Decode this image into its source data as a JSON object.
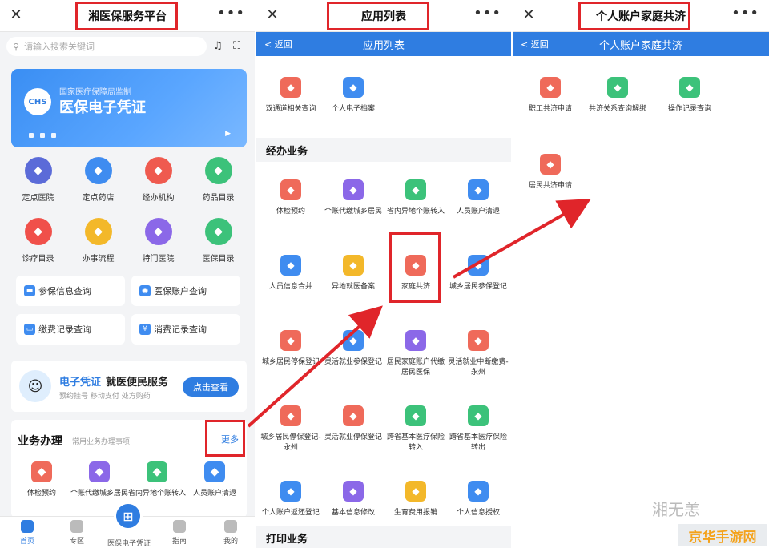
{
  "colors": {
    "accent": "#2f7de1",
    "highlight": "#e0252a"
  },
  "panel1": {
    "title": "湘医保服务平台",
    "close_icon": "close-icon",
    "more_icon": "more-icon",
    "search_placeholder": "请输入搜索关键词",
    "banner": {
      "sub": "国家医疗保障局监制",
      "title": "医保电子凭证",
      "logo": "CHS"
    },
    "grid": [
      {
        "label": "定点医院",
        "color": "#5b6bd8",
        "icon": "hospital-icon"
      },
      {
        "label": "定点药店",
        "color": "#3f8cf0",
        "icon": "pharmacy-icon"
      },
      {
        "label": "经办机构",
        "color": "#ef5a4f",
        "icon": "agency-icon"
      },
      {
        "label": "药品目录",
        "color": "#3cc27a",
        "icon": "medicine-icon"
      },
      {
        "label": "诊疗目录",
        "color": "#f0504a",
        "icon": "treatment-icon"
      },
      {
        "label": "办事流程",
        "color": "#f3b82a",
        "icon": "process-icon"
      },
      {
        "label": "特门医院",
        "color": "#8b68e8",
        "icon": "special-hospital-icon"
      },
      {
        "label": "医保目录",
        "color": "#3cc27a",
        "icon": "catalog-icon"
      }
    ],
    "quick": [
      {
        "label": "参保信息查询",
        "color": "#3f8cf0"
      },
      {
        "label": "医保账户查询",
        "color": "#3f8cf0"
      },
      {
        "label": "缴费记录查询",
        "color": "#3f8cf0"
      },
      {
        "label": "消费记录查询",
        "color": "#3f8cf0"
      }
    ],
    "evc": {
      "title": "电子凭证",
      "title2": "就医便民服务",
      "desc": "预约挂号   移动支付   处方购药",
      "button": "点击查看"
    },
    "biz": {
      "title": "业务办理",
      "sub": "常用业务办理事项",
      "more": "更多",
      "items": [
        {
          "label": "体检预约",
          "color": "#ef6a5a"
        },
        {
          "label": "个账代缴城乡居民",
          "color": "#8b68e8"
        },
        {
          "label": "省内异地个账转入",
          "color": "#3cc27a"
        },
        {
          "label": "人员账户清退",
          "color": "#3f8cf0"
        }
      ]
    },
    "nav": [
      {
        "label": "首页"
      },
      {
        "label": "专区"
      },
      {
        "label": "医保电子凭证"
      },
      {
        "label": "指南"
      },
      {
        "label": "我的"
      }
    ]
  },
  "panel2": {
    "title": "应用列表",
    "back": "< 返回",
    "subtitle": "应用列表",
    "top_items": [
      {
        "label": "双通道相关查询",
        "color": "#ef6a5a"
      },
      {
        "label": "个人电子档案",
        "color": "#3f8cf0"
      }
    ],
    "section1": "经办业务",
    "items": [
      {
        "label": "体检预约",
        "color": "#ef6a5a"
      },
      {
        "label": "个账代缴城乡居民",
        "color": "#8b68e8"
      },
      {
        "label": "省内异地个账转入",
        "color": "#3cc27a"
      },
      {
        "label": "人员账户清退",
        "color": "#3f8cf0"
      },
      {
        "label": "人员信息合并",
        "color": "#3f8cf0"
      },
      {
        "label": "异地就医备案",
        "color": "#f3b82a"
      },
      {
        "label": "家庭共济",
        "color": "#ef6a5a"
      },
      {
        "label": "城乡居民参保登记",
        "color": "#3f8cf0"
      },
      {
        "label": "城乡居民停保登记",
        "color": "#ef6a5a"
      },
      {
        "label": "灵活就业参保登记",
        "color": "#3f8cf0"
      },
      {
        "label": "居民家庭账户代缴居民医保",
        "color": "#8b68e8"
      },
      {
        "label": "灵活就业中断缴费-永州",
        "color": "#ef6a5a"
      },
      {
        "label": "城乡居民停保登记-永州",
        "color": "#ef6a5a"
      },
      {
        "label": "灵活就业停保登记",
        "color": "#ef6a5a"
      },
      {
        "label": "跨省基本医疗保险转入",
        "color": "#3cc27a"
      },
      {
        "label": "跨省基本医疗保险转出",
        "color": "#3cc27a"
      },
      {
        "label": "个人账户返还登记",
        "color": "#3f8cf0"
      },
      {
        "label": "基本信息修改",
        "color": "#8b68e8"
      },
      {
        "label": "生育费用报销",
        "color": "#f3b82a"
      },
      {
        "label": "个人信息授权",
        "color": "#3f8cf0"
      }
    ],
    "section2": "打印业务"
  },
  "panel3": {
    "title": "个人账户家庭共济",
    "back": "< 返回",
    "subtitle": "个人账户家庭共济",
    "items": [
      {
        "label": "职工共济申请",
        "color": "#ef6a5a"
      },
      {
        "label": "共济关系查询解绑",
        "color": "#3cc27a"
      },
      {
        "label": "操作记录查询",
        "color": "#3cc27a"
      },
      {
        "label": "居民共济申请",
        "color": "#ef6a5a"
      }
    ]
  },
  "watermark": {
    "wechat": "湘无恙",
    "site": "京华手游网"
  }
}
